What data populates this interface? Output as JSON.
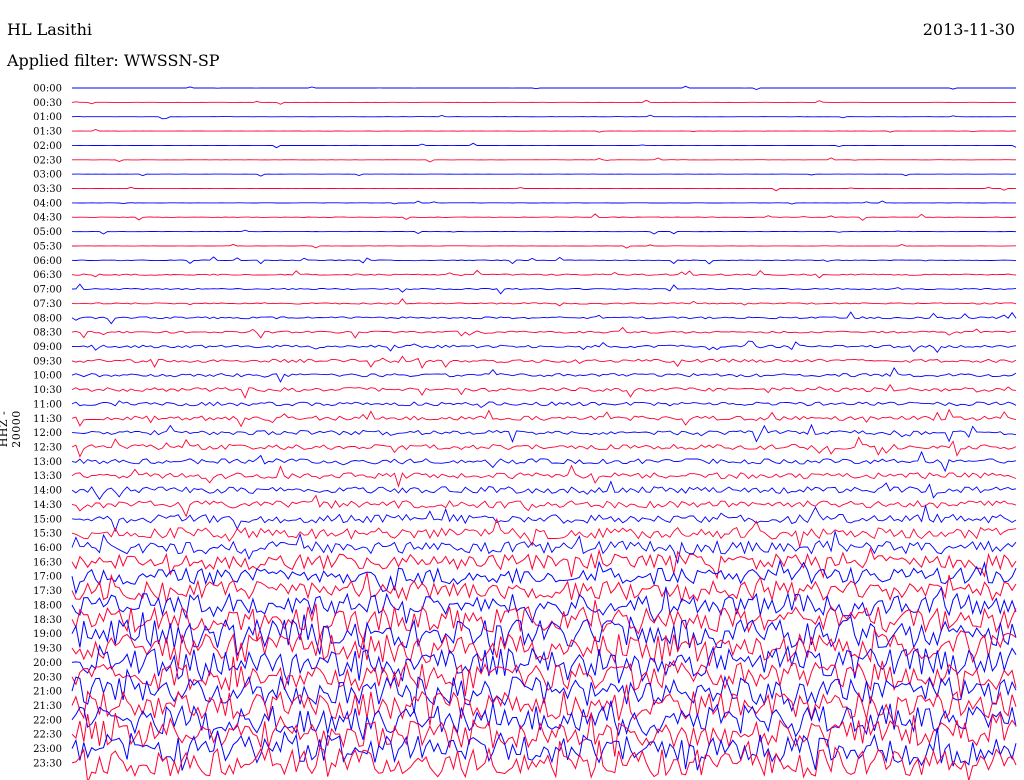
{
  "header": {
    "station": "HL Lasithi",
    "date": "2013-11-30",
    "filter_label": "Applied filter:",
    "filter_value": "WWSSN-SP"
  },
  "axis": {
    "ylabel": "HHZ - 20000"
  },
  "colors": {
    "trace_even": "#0000ff",
    "trace_odd": "#ff0033",
    "background": "#ffffff",
    "text": "#000000"
  },
  "chart_data": {
    "type": "line",
    "title": "HL Lasithi",
    "subtitle": "Applied filter: WWSSN-SP",
    "xlabel": "",
    "ylabel": "HHZ - 20000",
    "grid": false,
    "legend": "none",
    "row_labels": [
      "00:00",
      "00:30",
      "01:00",
      "01:30",
      "02:00",
      "02:30",
      "03:00",
      "03:30",
      "04:00",
      "04:30",
      "05:00",
      "05:30",
      "06:00",
      "06:30",
      "07:00",
      "07:30",
      "08:00",
      "08:30",
      "09:00",
      "09:30",
      "10:00",
      "10:30",
      "11:00",
      "11:30",
      "12:00",
      "12:30",
      "13:00",
      "13:30",
      "14:00",
      "14:30",
      "15:00",
      "15:30",
      "16:00",
      "16:30",
      "17:00",
      "17:30",
      "18:00",
      "18:30",
      "19:00",
      "19:30",
      "20:00",
      "20:30",
      "21:00",
      "21:30",
      "22:00",
      "22:30",
      "23:00",
      "23:30"
    ],
    "series": [
      {
        "name": "00:00",
        "color": "#0000ff",
        "noise_level": 0.02
      },
      {
        "name": "00:30",
        "color": "#ff0033",
        "noise_level": 0.02
      },
      {
        "name": "01:00",
        "color": "#0000ff",
        "noise_level": 0.03
      },
      {
        "name": "01:30",
        "color": "#ff0033",
        "noise_level": 0.03
      },
      {
        "name": "02:00",
        "color": "#0000ff",
        "noise_level": 0.03
      },
      {
        "name": "02:30",
        "color": "#ff0033",
        "noise_level": 0.03
      },
      {
        "name": "03:00",
        "color": "#0000ff",
        "noise_level": 0.03
      },
      {
        "name": "03:30",
        "color": "#ff0033",
        "noise_level": 0.03
      },
      {
        "name": "04:00",
        "color": "#0000ff",
        "noise_level": 0.04
      },
      {
        "name": "04:30",
        "color": "#ff0033",
        "noise_level": 0.06
      },
      {
        "name": "05:00",
        "color": "#0000ff",
        "noise_level": 0.04
      },
      {
        "name": "05:30",
        "color": "#ff0033",
        "noise_level": 0.05
      },
      {
        "name": "06:00",
        "color": "#0000ff",
        "noise_level": 0.08
      },
      {
        "name": "06:30",
        "color": "#ff0033",
        "noise_level": 0.12
      },
      {
        "name": "07:00",
        "color": "#0000ff",
        "noise_level": 0.12
      },
      {
        "name": "07:30",
        "color": "#ff0033",
        "noise_level": 0.12
      },
      {
        "name": "08:00",
        "color": "#0000ff",
        "noise_level": 0.15
      },
      {
        "name": "08:30",
        "color": "#ff0033",
        "noise_level": 0.15
      },
      {
        "name": "09:00",
        "color": "#0000ff",
        "noise_level": 0.18
      },
      {
        "name": "09:30",
        "color": "#ff0033",
        "noise_level": 0.2
      },
      {
        "name": "10:00",
        "color": "#0000ff",
        "noise_level": 0.2
      },
      {
        "name": "10:30",
        "color": "#ff0033",
        "noise_level": 0.22
      },
      {
        "name": "11:00",
        "color": "#0000ff",
        "noise_level": 0.22
      },
      {
        "name": "11:30",
        "color": "#ff0033",
        "noise_level": 0.24
      },
      {
        "name": "12:00",
        "color": "#0000ff",
        "noise_level": 0.24
      },
      {
        "name": "12:30",
        "color": "#ff0033",
        "noise_level": 0.26
      },
      {
        "name": "13:00",
        "color": "#0000ff",
        "noise_level": 0.26
      },
      {
        "name": "13:30",
        "color": "#ff0033",
        "noise_level": 0.28
      },
      {
        "name": "14:00",
        "color": "#0000ff",
        "noise_level": 0.3
      },
      {
        "name": "14:30",
        "color": "#ff0033",
        "noise_level": 0.32
      },
      {
        "name": "15:00",
        "color": "#0000ff",
        "noise_level": 0.35
      },
      {
        "name": "15:30",
        "color": "#ff0033",
        "noise_level": 0.4
      },
      {
        "name": "16:00",
        "color": "#0000ff",
        "noise_level": 0.45
      },
      {
        "name": "16:30",
        "color": "#ff0033",
        "noise_level": 0.55
      },
      {
        "name": "17:00",
        "color": "#0000ff",
        "noise_level": 0.6
      },
      {
        "name": "17:30",
        "color": "#ff0033",
        "noise_level": 0.7
      },
      {
        "name": "18:00",
        "color": "#0000ff",
        "noise_level": 0.8
      },
      {
        "name": "18:30",
        "color": "#ff0033",
        "noise_level": 0.9
      },
      {
        "name": "19:00",
        "color": "#0000ff",
        "noise_level": 1.0
      },
      {
        "name": "19:30",
        "color": "#ff0033",
        "noise_level": 1.0
      },
      {
        "name": "20:00",
        "color": "#0000ff",
        "noise_level": 1.0
      },
      {
        "name": "20:30",
        "color": "#ff0033",
        "noise_level": 1.0
      },
      {
        "name": "21:00",
        "color": "#0000ff",
        "noise_level": 1.0
      },
      {
        "name": "21:30",
        "color": "#ff0033",
        "noise_level": 1.0
      },
      {
        "name": "22:00",
        "color": "#0000ff",
        "noise_level": 1.0
      },
      {
        "name": "22:30",
        "color": "#ff0033",
        "noise_level": 1.0
      },
      {
        "name": "23:00",
        "color": "#0000ff",
        "noise_level": 1.0
      },
      {
        "name": "23:30",
        "color": "#ff0033",
        "noise_level": 1.0
      }
    ]
  }
}
